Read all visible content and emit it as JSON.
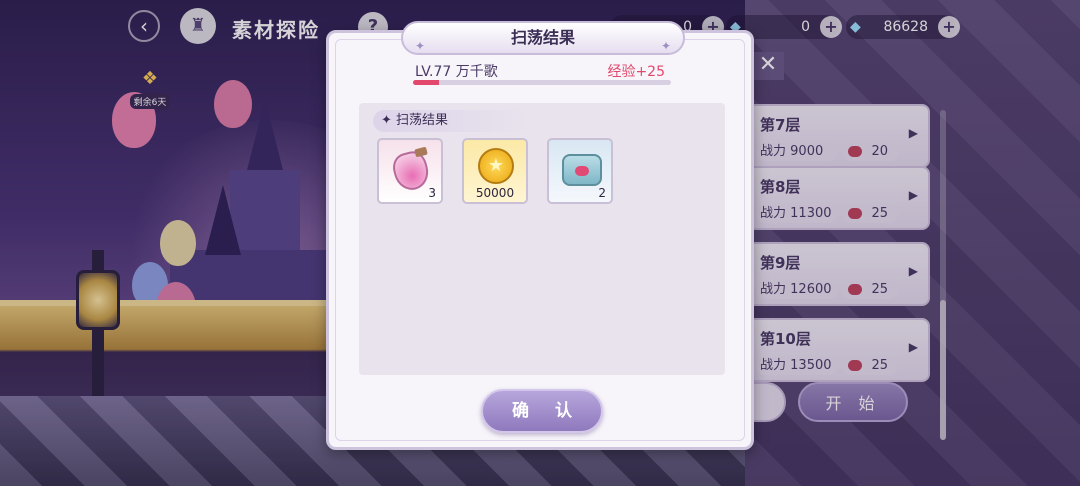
{
  "header": {
    "back_icon": "back-arrow-icon",
    "castle_icon": "castle-icon",
    "title": "素材探险",
    "help_label": "?"
  },
  "resources": {
    "gold_partial": "0",
    "gems_a": "0",
    "gems_b": "86628"
  },
  "event_badge": {
    "label": "剩余6天"
  },
  "floors": [
    {
      "name": "第7层",
      "power_label": "战力",
      "power": "9000",
      "cost": "20"
    },
    {
      "name": "第8层",
      "power_label": "战力",
      "power": "11300",
      "cost": "25"
    },
    {
      "name": "第9层",
      "power_label": "战力",
      "power": "12600",
      "cost": "25"
    },
    {
      "name": "第10层",
      "power_label": "战力",
      "power": "13500",
      "cost": "25"
    }
  ],
  "start_button": "开 始",
  "modal": {
    "title": "扫荡结果",
    "level_text": "LV.77 万千歌",
    "exp_text": "经验+25",
    "exp_progress": 0.1,
    "panel_header": "扫荡结果",
    "items": [
      {
        "name": "potion-icon",
        "qty": "3"
      },
      {
        "name": "gold-coin-icon",
        "qty": "50000"
      },
      {
        "name": "can-icon",
        "qty": "2"
      }
    ],
    "confirm_label": "确 认"
  },
  "colors": {
    "exp_accent": "#e2486c",
    "confirm_bg": "#9f8dc9"
  }
}
